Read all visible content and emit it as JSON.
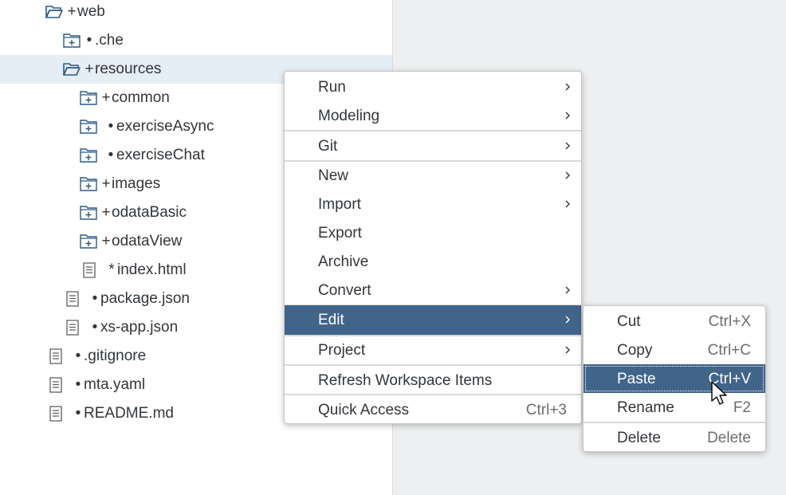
{
  "icons": {
    "folder_open": "folder-open-icon",
    "folder_closed": "folder-plus-icon",
    "file": "file-icon"
  },
  "colors": {
    "accent": "#416489",
    "selection_row": "#e5edf5",
    "editor_bg": "#edeff0",
    "icon_blue": "#2d5a85"
  },
  "tree": [
    {
      "marker": "+",
      "name": "web",
      "icon": "folder-open"
    },
    {
      "marker": "•",
      "name": ".che",
      "icon": "folder"
    },
    {
      "marker": "+",
      "name": "resources",
      "icon": "folder-open"
    },
    {
      "marker": "+",
      "name": "common",
      "icon": "folder"
    },
    {
      "marker": "•",
      "name": "exerciseAsync",
      "icon": "folder"
    },
    {
      "marker": "•",
      "name": "exerciseChat",
      "icon": "folder"
    },
    {
      "marker": "+",
      "name": "images",
      "icon": "folder"
    },
    {
      "marker": "+",
      "name": "odataBasic",
      "icon": "folder"
    },
    {
      "marker": "+",
      "name": "odataView",
      "icon": "folder"
    },
    {
      "marker": "*",
      "name": "index.html",
      "icon": "file"
    },
    {
      "marker": "•",
      "name": "package.json",
      "icon": "file"
    },
    {
      "marker": "•",
      "name": "xs-app.json",
      "icon": "file"
    },
    {
      "marker": "•",
      "name": ".gitignore",
      "icon": "file"
    },
    {
      "marker": "•",
      "name": "mta.yaml",
      "icon": "file"
    },
    {
      "marker": "•",
      "name": "README.md",
      "icon": "file"
    }
  ],
  "context_menu": {
    "items": [
      {
        "label": "Run",
        "has_submenu": true
      },
      {
        "label": "Modeling",
        "has_submenu": true
      },
      {
        "label": "Git",
        "has_submenu": true
      },
      {
        "label": "New",
        "has_submenu": true
      },
      {
        "label": "Import",
        "has_submenu": true
      },
      {
        "label": "Export",
        "has_submenu": false
      },
      {
        "label": "Archive",
        "has_submenu": false
      },
      {
        "label": "Convert",
        "has_submenu": true
      },
      {
        "label": "Edit",
        "has_submenu": true,
        "active": true
      },
      {
        "label": "Project",
        "has_submenu": true
      },
      {
        "label": "Refresh Workspace Items",
        "has_submenu": false
      },
      {
        "label": "Quick Access",
        "shortcut": "Ctrl+3"
      }
    ]
  },
  "edit_submenu": {
    "items": [
      {
        "label": "Cut",
        "shortcut": "Ctrl+X"
      },
      {
        "label": "Copy",
        "shortcut": "Ctrl+C"
      },
      {
        "label": "Paste",
        "shortcut": "Ctrl+V",
        "active": true
      },
      {
        "label": "Rename",
        "shortcut": "F2"
      },
      {
        "label": "Delete",
        "shortcut": "Delete"
      }
    ]
  }
}
